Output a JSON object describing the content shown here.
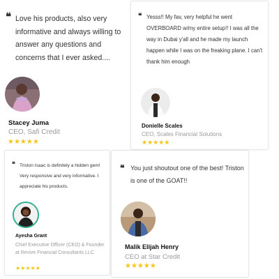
{
  "testimonials": [
    {
      "quote": "Love his products, also very informative and always willing to answer any questions and concerns that I ever asked....",
      "name": "Stacey Juma",
      "role": "CEO, Safi Credit",
      "stars": "★★★★★",
      "rating": 5,
      "avatar_bg": "#8a6f74"
    },
    {
      "quote": "Yesss!! My fav, very helpful he went OVERBOARD w/my entire setup!! I was all the way in Dubai y'all and he made my launch happen while I was on the freaking plane. I can't thank him enough",
      "name": "Donielle Scales",
      "role": "CEO, Scales Financial Solutions",
      "stars": "★★★★★",
      "rating": 5,
      "avatar_bg": "#e9e9e9"
    },
    {
      "quote": "Triston Isaac is definitely a hidden gem! Very responsive and very informative. I appreciate his products.",
      "name": "Ayesha Grant",
      "role": "Chief Executive Officer (CEO) & Founder at Revive Financial Consultants LLC",
      "stars": "★★★★★",
      "rating": 5,
      "avatar_bg": "#f2f2f2"
    },
    {
      "quote": "You just shoutout one of the best! Triston is one of the GOAT!!",
      "name": "Malik Elijah Henry",
      "role": "CEO at Star Credit",
      "stars": "★★★★★",
      "rating": 5,
      "avatar_bg": "#b89a79"
    }
  ],
  "quote_glyph": "❝",
  "colors": {
    "star": "#f7c414",
    "role_text": "#9a9a9a",
    "name_text": "#111111",
    "card_border": "#e6e6e6",
    "avatar_ring": "#2eaf8e"
  }
}
